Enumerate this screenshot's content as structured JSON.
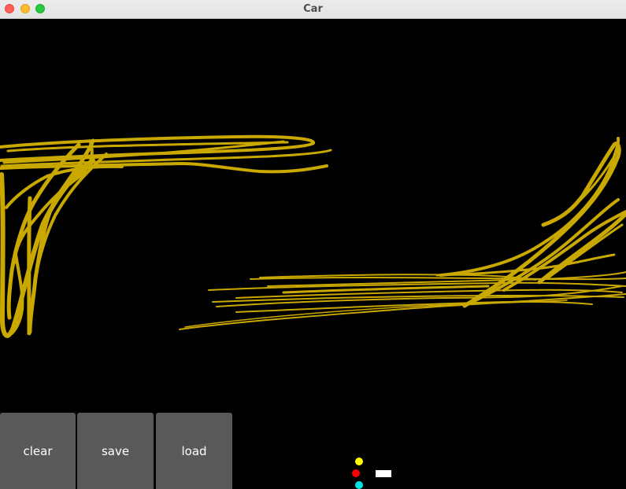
{
  "window": {
    "title": "Car"
  },
  "toolbar": {
    "clear_label": "clear",
    "save_label": "save",
    "load_label": "load"
  },
  "palette": {
    "colors": [
      "#ffff00",
      "#ff0000",
      "#00e5e5"
    ],
    "brush_swatch_color": "#ffffff"
  },
  "drawing": {
    "stroke_color": "#c9a800",
    "background": "#000000"
  }
}
